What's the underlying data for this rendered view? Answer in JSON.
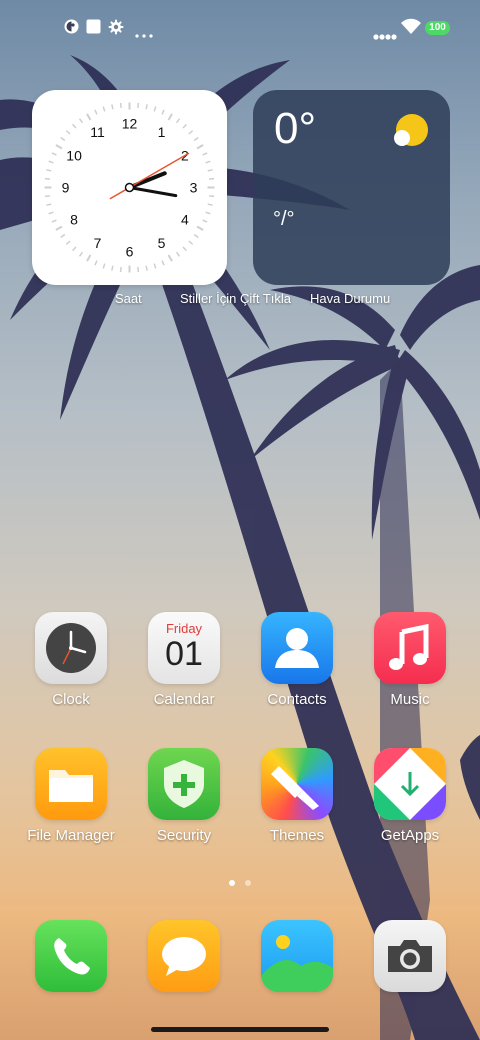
{
  "status_bar": {
    "left_icons": [
      "notification-app-icon",
      "square-notification-icon",
      "gear-icon",
      "more-dots-icon"
    ],
    "battery": "100"
  },
  "widgets": {
    "clock": {
      "numbers": [
        "12",
        "1",
        "2",
        "3",
        "4",
        "5",
        "6",
        "7",
        "8",
        "9",
        "10",
        "11"
      ],
      "label": "Saat",
      "time": "2:16:40"
    },
    "weather": {
      "temp": "0°",
      "range": "°/°",
      "label": "Hava Durumu"
    },
    "hint": "Stiller İçin Çift Tıkla"
  },
  "apps": [
    {
      "label": "Clock",
      "icon": "clock-app-icon"
    },
    {
      "label": "Calendar",
      "icon": "calendar-app-icon",
      "day": "Friday",
      "date": "01"
    },
    {
      "label": "Contacts",
      "icon": "contacts-app-icon"
    },
    {
      "label": "Music",
      "icon": "music-app-icon"
    },
    {
      "label": "File Manager",
      "icon": "folder-icon"
    },
    {
      "label": "Security",
      "icon": "security-shield-icon"
    },
    {
      "label": "Themes",
      "icon": "themes-brush-icon"
    },
    {
      "label": "GetApps",
      "icon": "getapps-icon"
    }
  ],
  "dock": [
    {
      "icon": "phone-icon"
    },
    {
      "icon": "messages-icon"
    },
    {
      "icon": "gallery-icon"
    },
    {
      "icon": "camera-icon"
    }
  ],
  "page_indicator": {
    "pages": 2,
    "current": 1
  },
  "colors": {
    "weather_bg": "#2f3e58",
    "sun": "#f5c518",
    "second_hand": "#e8542e"
  }
}
